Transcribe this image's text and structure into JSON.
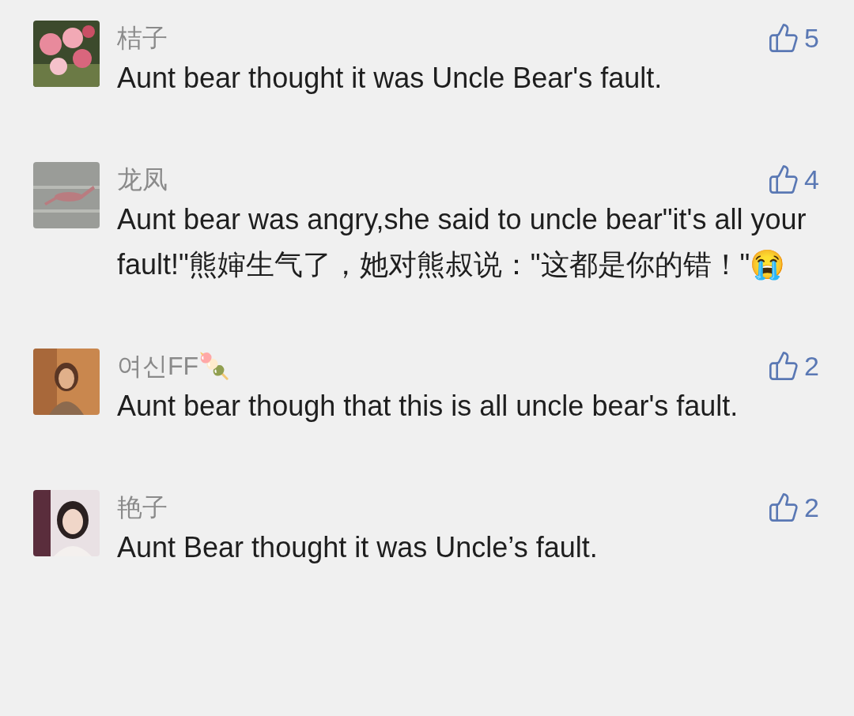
{
  "comments": [
    {
      "name": "桔子",
      "likes": "5",
      "text": "Aunt bear thought it was Uncle Bear's fault."
    },
    {
      "name": "龙凤",
      "likes": "4",
      "text": "Aunt bear was angry,she said to uncle bear\"it's all your fault!\"熊婶生气了，她对熊叔说：\"这都是你的错！\"😭"
    },
    {
      "name": "여신FF🍡",
      "likes": "2",
      "text": "Aunt bear though that this is all uncle bear's fault."
    },
    {
      "name": "艳子",
      "likes": "2",
      "text": "Aunt Bear thought it was Uncle’s fault."
    }
  ]
}
